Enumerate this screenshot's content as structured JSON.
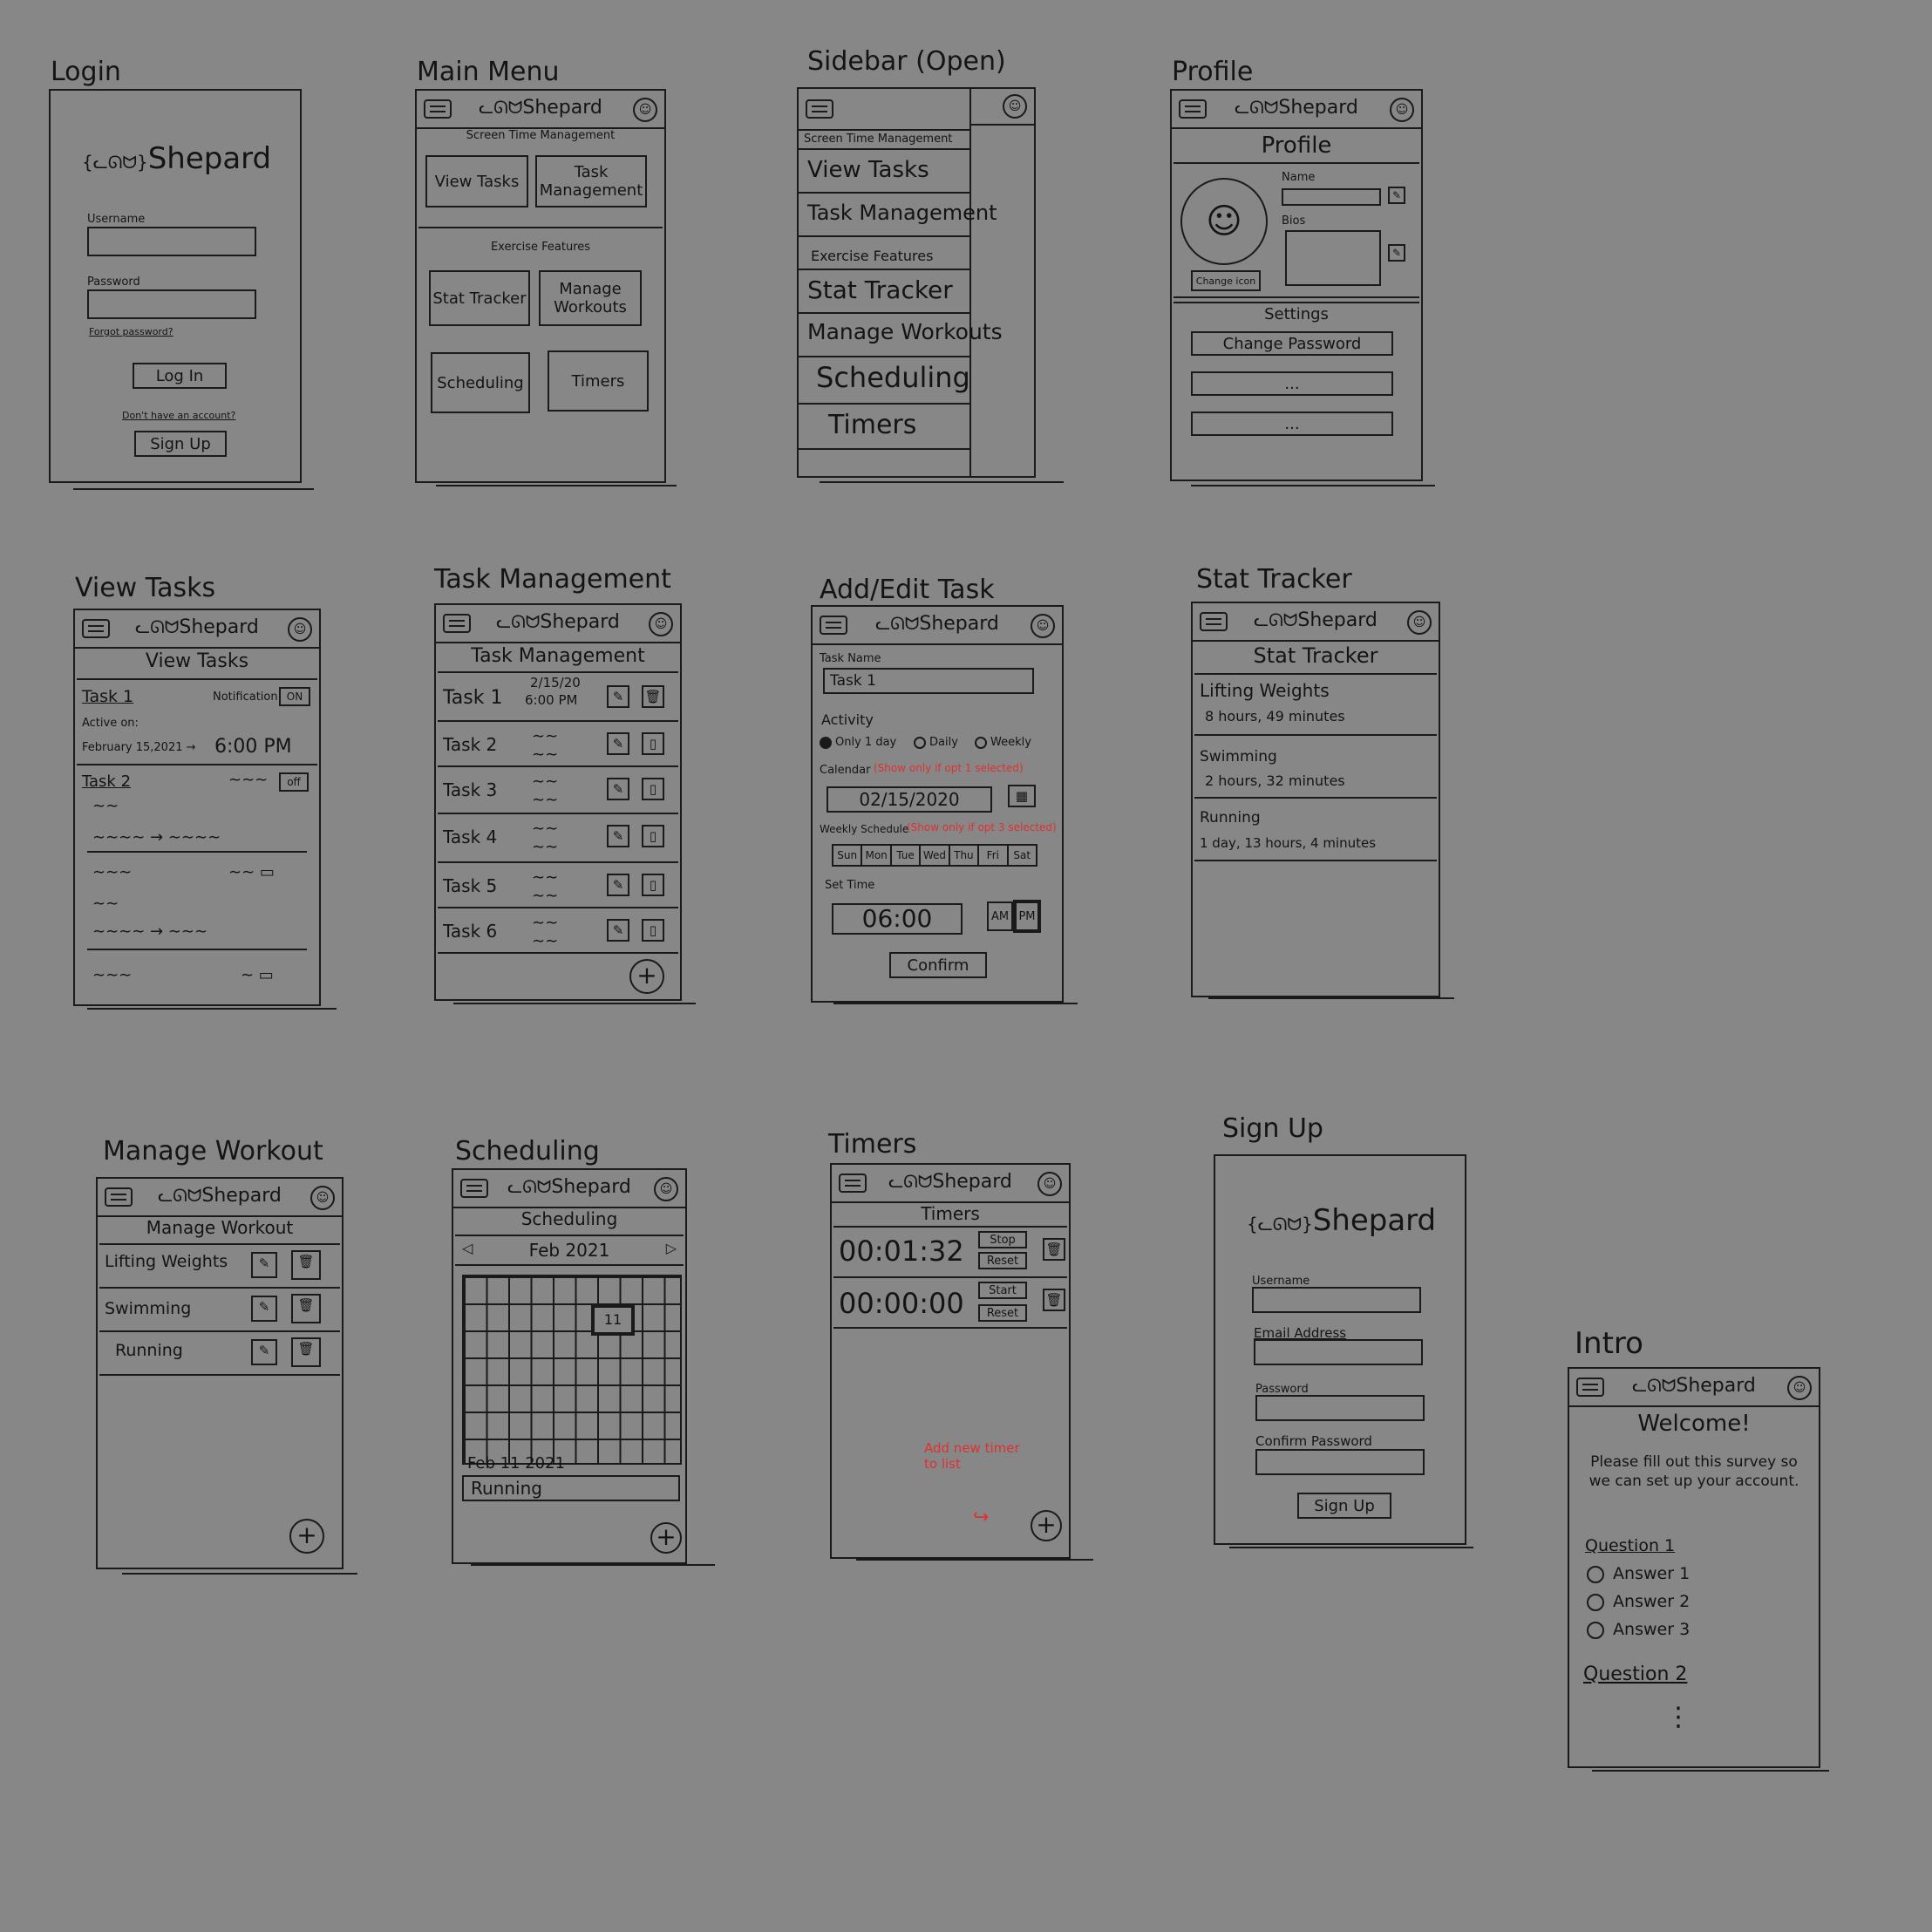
{
  "brand": "Shepard",
  "login": {
    "title": "Login",
    "username": "Username",
    "password": "Password",
    "forgot": "Forgot password?",
    "login_btn": "Log In",
    "no_account": "Don't have an account?",
    "signup_btn": "Sign Up"
  },
  "main_menu": {
    "title": "Main Menu",
    "section1": "Screen Time Management",
    "btn_view_tasks": "View Tasks",
    "btn_task_mgmt": "Task Management",
    "section2": "Exercise Features",
    "btn_stat": "Stat Tracker",
    "btn_manage": "Manage Workouts",
    "btn_sched": "Scheduling",
    "btn_timers": "Timers"
  },
  "sidebar": {
    "title": "Sidebar (Open)",
    "items": [
      "Screen Time Management",
      "View Tasks",
      "Task Management",
      "Exercise Features",
      "Stat Tracker",
      "Manage Workouts",
      "Scheduling",
      "Timers"
    ]
  },
  "profile": {
    "title": "Profile",
    "heading": "Profile",
    "name": "Name",
    "bios": "Bios",
    "change_icon": "Change icon",
    "settings": "Settings",
    "change_password": "Change Password",
    "more1": "...",
    "more2": "..."
  },
  "view_tasks": {
    "title": "View Tasks",
    "heading": "View Tasks",
    "task1": "Task 1",
    "notification": "Notification:",
    "toggle_on": "ON",
    "active_on": "Active on:",
    "date": "February 15,2021 →",
    "time": "6:00 PM",
    "task2": "Task 2",
    "toggle_off": "off"
  },
  "task_mgmt": {
    "title": "Task Management",
    "heading": "Task Management",
    "tasks": [
      "Task 1",
      "Task 2",
      "Task 3",
      "Task 4",
      "Task 5",
      "Task 6"
    ],
    "t1_date": "2/15/20",
    "t1_time": "6:00 PM"
  },
  "add_edit": {
    "title": "Add/Edit Task",
    "task_name_label": "Task Name",
    "task_name": "Task 1",
    "activity": "Activity",
    "opt1": "Only 1 day",
    "opt2": "Daily",
    "opt3": "Weekly",
    "calendar": "Calendar",
    "cal_note": "(Show only if opt 1 selected)",
    "date": "02/15/2020",
    "weekly": "Weekly Schedule",
    "weekly_note": "(Show only if opt 3 selected)",
    "days": [
      "Sun",
      "Mon",
      "Tue",
      "Wed",
      "Thu",
      "Fri",
      "Sat"
    ],
    "set_time": "Set Time",
    "time": "06:00",
    "am": "AM",
    "pm": "PM",
    "confirm": "Confirm"
  },
  "stat_tracker": {
    "title": "Stat Tracker",
    "heading": "Stat Tracker",
    "entries": [
      {
        "name": "Lifting Weights",
        "value": "8 hours, 49 minutes"
      },
      {
        "name": "Swimming",
        "value": "2 hours, 32 minutes"
      },
      {
        "name": "Running",
        "value": "1 day, 13 hours, 4 minutes"
      }
    ]
  },
  "manage_workout": {
    "title": "Manage Workout",
    "heading": "Manage Workout",
    "items": [
      "Lifting Weights",
      "Swimming",
      "Running"
    ]
  },
  "scheduling": {
    "title": "Scheduling",
    "heading": "Scheduling",
    "month": "Feb 2021",
    "selected_day": "11",
    "date": "Feb 11 2021",
    "event": "Running"
  },
  "timers": {
    "title": "Timers",
    "heading": "Timers",
    "t1": "00:01:32",
    "t1_a": "Stop",
    "t1_b": "Reset",
    "t2": "00:00:00",
    "t2_a": "Start",
    "t2_b": "Reset",
    "note": "Add new timer to list"
  },
  "signup": {
    "title": "Sign Up",
    "username": "Username",
    "email": "Email Address",
    "password": "Password",
    "confirm": "Confirm Password",
    "btn": "Sign Up"
  },
  "intro": {
    "title": "Intro",
    "welcome": "Welcome!",
    "desc": "Please fill out this survey so we can set up your account.",
    "q1": "Question 1",
    "answers": [
      "Answer 1",
      "Answer 2",
      "Answer 3"
    ],
    "q2": "Question 2",
    "more": "⋮"
  },
  "colors": {
    "background": "#878787",
    "ink": "#141414",
    "annotation": "#e03030"
  }
}
